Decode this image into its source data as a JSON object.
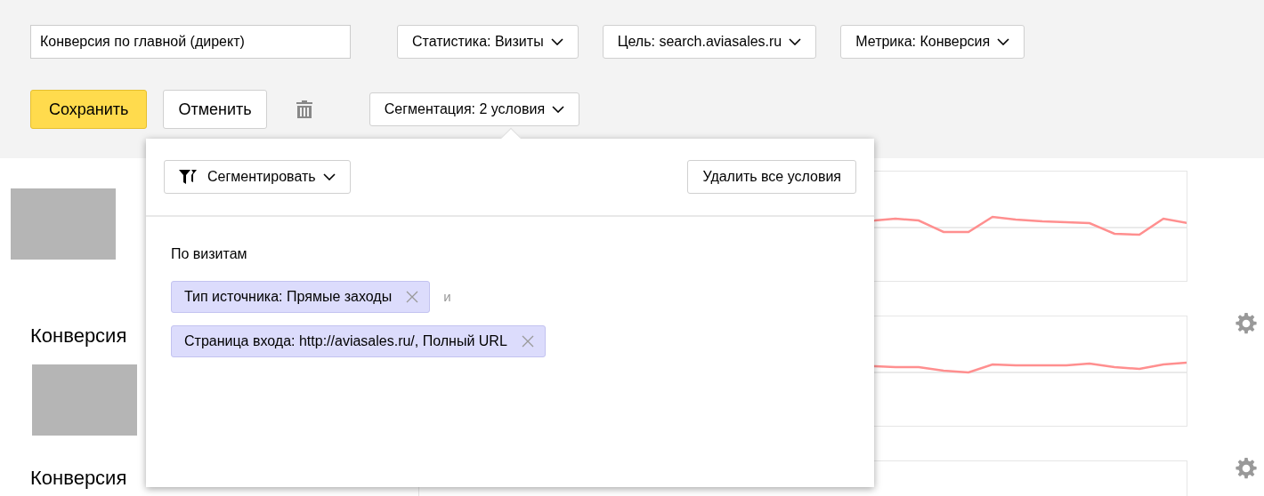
{
  "toolbar": {
    "name_field": {
      "value": "Конверсия по главной (директ)"
    },
    "selectors": [
      "Статистика: Визиты",
      "Цель: search.aviasales.ru",
      "Метрика: Конверсия"
    ],
    "save_button": "Сохранить",
    "cancel_button": "Отменить",
    "segmentation_dropdown": {
      "label": "Сегментация: 2 условия"
    }
  },
  "segmentation_popup": {
    "segment_button": "Сегментировать",
    "delete_all_button": "Удалить все условия",
    "section_title": "По визитам",
    "conjunction": "и",
    "conditions": [
      {
        "label": "Тип источника: Прямые заходы"
      },
      {
        "label": "Страница входа: http://aviasales.ru/, Полный URL"
      }
    ]
  },
  "widgets": [
    {
      "title": "Конверсия"
    },
    {
      "title": "Конверсия"
    }
  ]
}
